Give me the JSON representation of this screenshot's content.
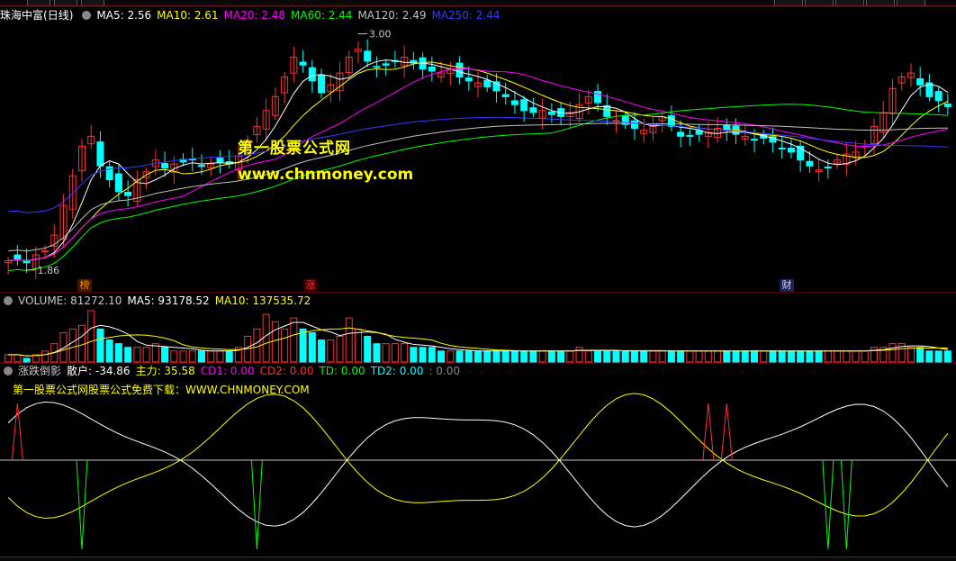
{
  "stock": {
    "name": "珠海中富",
    "period": "(日线)"
  },
  "ma_legend": [
    {
      "label": "MA5: 2.56",
      "color": "#ffffff"
    },
    {
      "label": "MA10: 2.61",
      "color": "#ffff00"
    },
    {
      "label": "MA20: 2.48",
      "color": "#ff00ff"
    },
    {
      "label": "MA60: 2.44",
      "color": "#00ff00"
    },
    {
      "label": "MA120: 2.49",
      "color": "#c0c0c0"
    },
    {
      "label": "MA250: 2.44",
      "color": "#3a3aff"
    }
  ],
  "price_labels": {
    "high": "3.00",
    "low": "1.86"
  },
  "watermark": {
    "line1": "第一股票公式网",
    "line2": "www.chnmoney.com"
  },
  "event_tags": [
    {
      "label": "榜",
      "color": "#ff8800"
    },
    {
      "label": "涨",
      "color": "#ff3030"
    },
    {
      "label": "财",
      "color": "#cfd8ff"
    }
  ],
  "volume_legend": [
    {
      "label": "VOLUME: 81272.10",
      "color": "#c8c8c8"
    },
    {
      "label": "MA5: 93178.52",
      "color": "#ffffff"
    },
    {
      "label": "MA10: 137535.72",
      "color": "#ffff00"
    }
  ],
  "indicator_legend": [
    {
      "label": "涨跌倒影",
      "color": "#c8c8c8"
    },
    {
      "label": "散户: -34.86",
      "color": "#ffffff"
    },
    {
      "label": "主力: 35.58",
      "color": "#ffff00"
    },
    {
      "label": "CD1: 0.00",
      "color": "#ff00ff"
    },
    {
      "label": "CD2: 0.00",
      "color": "#ff3030"
    },
    {
      "label": "TD: 0.00",
      "color": "#00ff00"
    },
    {
      "label": "TD2: 0.00",
      "color": "#00ffff"
    },
    {
      "label": ": 0.00",
      "color": "#888888"
    }
  ],
  "indicator_note": "第一股票公式网股票公式免费下载：WWW.CHNMONEY.COM",
  "chart_data": {
    "type": "candlestick",
    "title": "珠海中富(日线)",
    "price_high_marker": 3.0,
    "price_low_marker": 1.86,
    "ylim": [
      1.8,
      3.08
    ],
    "closes": [
      1.87,
      1.88,
      1.86,
      1.9,
      1.92,
      2.0,
      2.15,
      2.3,
      2.45,
      2.5,
      2.35,
      2.28,
      2.22,
      2.2,
      2.28,
      2.32,
      2.38,
      2.34,
      2.36,
      2.37,
      2.38,
      2.35,
      2.36,
      2.37,
      2.36,
      2.4,
      2.48,
      2.55,
      2.63,
      2.7,
      2.8,
      2.9,
      2.86,
      2.78,
      2.72,
      2.76,
      2.82,
      2.9,
      2.94,
      2.88,
      2.85,
      2.86,
      2.88,
      2.9,
      2.87,
      2.84,
      2.83,
      2.82,
      2.84,
      2.8,
      2.78,
      2.77,
      2.75,
      2.73,
      2.7,
      2.66,
      2.63,
      2.62,
      2.63,
      2.61,
      2.6,
      2.62,
      2.66,
      2.7,
      2.67,
      2.6,
      2.58,
      2.56,
      2.54,
      2.53,
      2.55,
      2.6,
      2.55,
      2.5,
      2.5,
      2.51,
      2.52,
      2.54,
      2.53,
      2.51,
      2.5,
      2.48,
      2.49,
      2.47,
      2.44,
      2.42,
      2.38,
      2.35,
      2.33,
      2.34,
      2.38,
      2.41,
      2.42,
      2.45,
      2.55,
      2.62,
      2.74,
      2.8,
      2.82,
      2.76,
      2.7,
      2.68,
      2.65
    ],
    "ma_lines": [
      {
        "name": "MA5",
        "color": "#ffffff"
      },
      {
        "name": "MA10",
        "color": "#ffff00"
      },
      {
        "name": "MA20",
        "color": "#ff00ff"
      },
      {
        "name": "MA60",
        "color": "#00ff00"
      },
      {
        "name": "MA120",
        "color": "#c0c0c0"
      },
      {
        "name": "MA250",
        "color": "#3a3aff"
      }
    ],
    "volume": [
      2,
      2,
      1,
      2,
      3,
      5,
      8,
      9,
      10,
      14,
      9,
      6,
      5,
      4,
      4,
      4,
      5,
      4,
      3,
      3,
      3,
      3,
      3,
      3,
      3,
      4,
      7,
      9,
      13,
      11,
      9,
      12,
      9,
      8,
      6,
      6,
      7,
      12,
      9,
      7,
      5,
      5,
      5,
      5,
      4,
      4,
      4,
      3,
      3,
      3,
      3,
      3,
      3,
      3,
      3,
      3,
      3,
      3,
      3,
      3,
      3,
      3,
      4,
      3,
      3,
      3,
      3,
      3,
      3,
      3,
      3,
      3,
      3,
      3,
      3,
      3,
      3,
      3,
      3,
      3,
      3,
      3,
      3,
      3,
      3,
      3,
      3,
      3,
      3,
      3,
      3,
      3,
      3,
      3,
      4,
      4,
      5,
      5,
      4,
      4,
      3,
      3,
      3
    ],
    "indicator": {
      "series": [
        {
          "name": "散户",
          "color": "#ffffff"
        },
        {
          "name": "主力",
          "color": "#ffff00"
        },
        {
          "name": "CD2",
          "color": "#ff3030",
          "spikes": [
            1,
            76,
            78
          ]
        },
        {
          "name": "TD",
          "color": "#00ff00",
          "spikes": [
            8,
            27,
            89,
            91
          ]
        }
      ]
    }
  }
}
